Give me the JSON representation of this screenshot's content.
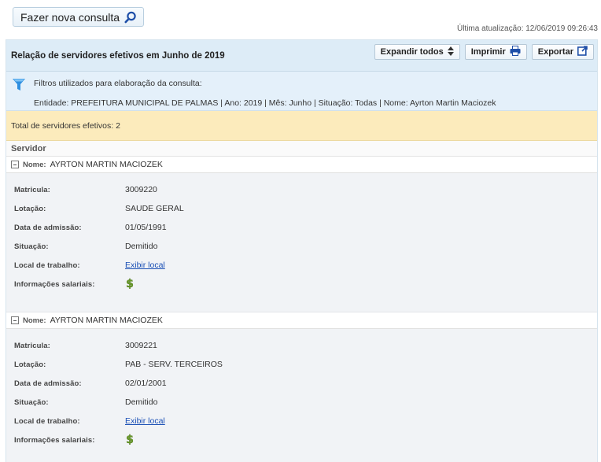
{
  "toolbar": {
    "new_query_label": "Fazer nova consulta"
  },
  "last_update": "Última atualização: 12/06/2019 09:26:43",
  "panel": {
    "title": "Relação de servidores efetivos em Junho de 2019",
    "expand_label": "Expandir todos",
    "print_label": "Imprimir",
    "export_label": "Exportar"
  },
  "filters": {
    "label": "Filtros utilizados para elaboração da consulta:",
    "detail": "Entidade: PREFEITURA MUNICIPAL DE PALMAS | Ano: 2019 | Mês: Junho | Situação: Todas | Nome: Ayrton Martin Maciozek"
  },
  "total": "Total de servidores efetivos: 2",
  "column_header": "Servidor",
  "labels": {
    "name": "Nome:",
    "matricula": "Matricula:",
    "lotacao": "Lotação:",
    "admissao": "Data de admissão:",
    "situacao": "Situação:",
    "local": "Local de trabalho:",
    "salario": "Informações salariais:"
  },
  "servers": [
    {
      "name": "AYRTON MARTIN MACIOZEK",
      "matricula": "3009220",
      "lotacao": "SAUDE GERAL",
      "admissao": "01/05/1991",
      "situacao": "Demitido",
      "local_link": "Exibir local"
    },
    {
      "name": "AYRTON MARTIN MACIOZEK",
      "matricula": "3009221",
      "lotacao": "PAB - SERV. TERCEIROS",
      "admissao": "02/01/2001",
      "situacao": "Demitido",
      "local_link": "Exibir local"
    }
  ],
  "colors": {
    "header_bg": "#ddecf7",
    "filter_bg": "#e4f0fa",
    "total_bg": "#fcebbc",
    "link": "#1a4fb5",
    "dollar": "#6a9a2a"
  }
}
